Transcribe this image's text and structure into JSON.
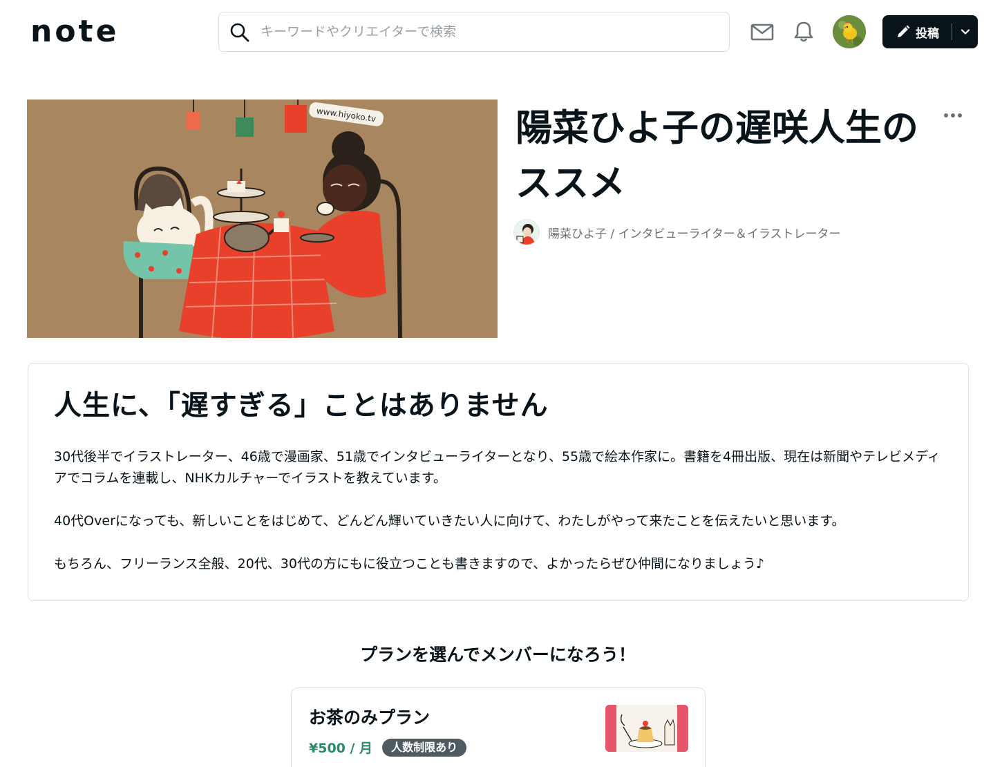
{
  "header": {
    "logo_text": "note",
    "search_placeholder": "キーワードやクリエイターで検索",
    "icons": [
      "search-icon",
      "mail-icon",
      "bell-icon"
    ],
    "post_label": "投稿"
  },
  "magazine": {
    "title": "陽菜ひよ子の遅咲人生のススメ",
    "author": "陽菜ひよ子 / インタビューライター＆イラストレーター",
    "hero_image_text": "www.hiyoko.tv"
  },
  "description": {
    "heading": "人生に、「遅すぎる」ことはありません",
    "paragraphs": [
      "30代後半でイラストレーター、46歳で漫画家、51歳でインタビューライターとなり、55歳で絵本作家に。書籍を4冊出版、現在は新聞やテレビメディアでコラムを連載し、NHKカルチャーでイラストを教えています。",
      "40代Overになっても、新しいことをはじめて、どんどん輝いていきたい人に向けて、わたしがやって来たことを伝えたいと思います。",
      "もちろん、フリーランス全般、20代、30代の方にもに役立つことも書きますので、よかったらぜひ仲間になりましょう♪"
    ]
  },
  "plans": {
    "heading": "プランを選んでメンバーになろう！",
    "items": [
      {
        "name": "お茶のみプラン",
        "price": "¥500 / 月",
        "badge": "人数制限あり"
      }
    ]
  },
  "colors": {
    "primary": "#08131a",
    "price_green": "#2b8a6e",
    "badge_bg": "#4e5b63",
    "hero_bg": "#a88760",
    "accent_red": "#e8402a"
  }
}
